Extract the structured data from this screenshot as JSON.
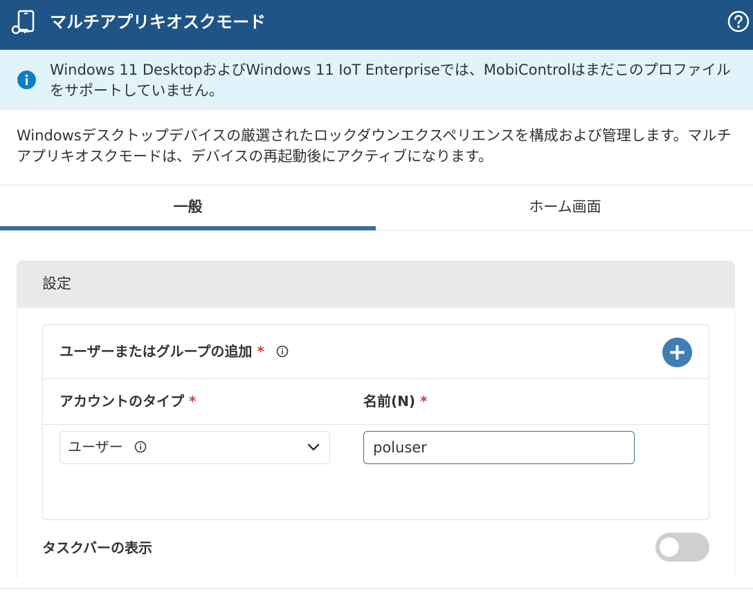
{
  "header": {
    "title": "マルチアプリキオスクモード",
    "icon": "kiosk-device-key-icon",
    "help_icon": "question-circle-icon",
    "background_color": "#1f5487"
  },
  "info_banner": {
    "icon": "info-icon",
    "text": "Windows 11 DesktopおよびWindows 11 IoT Enterpriseでは、MobiControlはまだこのプロファイルをサポートしていません。",
    "background_color": "#e1f4fb"
  },
  "description": "Windowsデスクトップデバイスの厳選されたロックダウンエクスペリエンスを構成および管理します。マルチアプリキオスクモードは、デバイスの再起動後にアクティブになります。",
  "tabs": [
    {
      "label": "一般",
      "selected": true
    },
    {
      "label": "ホーム画面",
      "selected": false
    }
  ],
  "settings": {
    "title": "設定",
    "user_section": {
      "title": "ユーザーまたはグループの追加",
      "required_mark": "*",
      "add_icon": "plus-circle-icon",
      "columns": {
        "account_type": "アカウントのタイプ",
        "name": "名前(N)"
      },
      "row": {
        "account_type_value": "ユーザー",
        "name_value": "poluser"
      }
    },
    "taskbar": {
      "label": "タスクバーの表示",
      "enabled": false
    }
  },
  "colors": {
    "accent": "#356e9e",
    "required": "#c8423a",
    "add_button": "#3f7db5"
  }
}
